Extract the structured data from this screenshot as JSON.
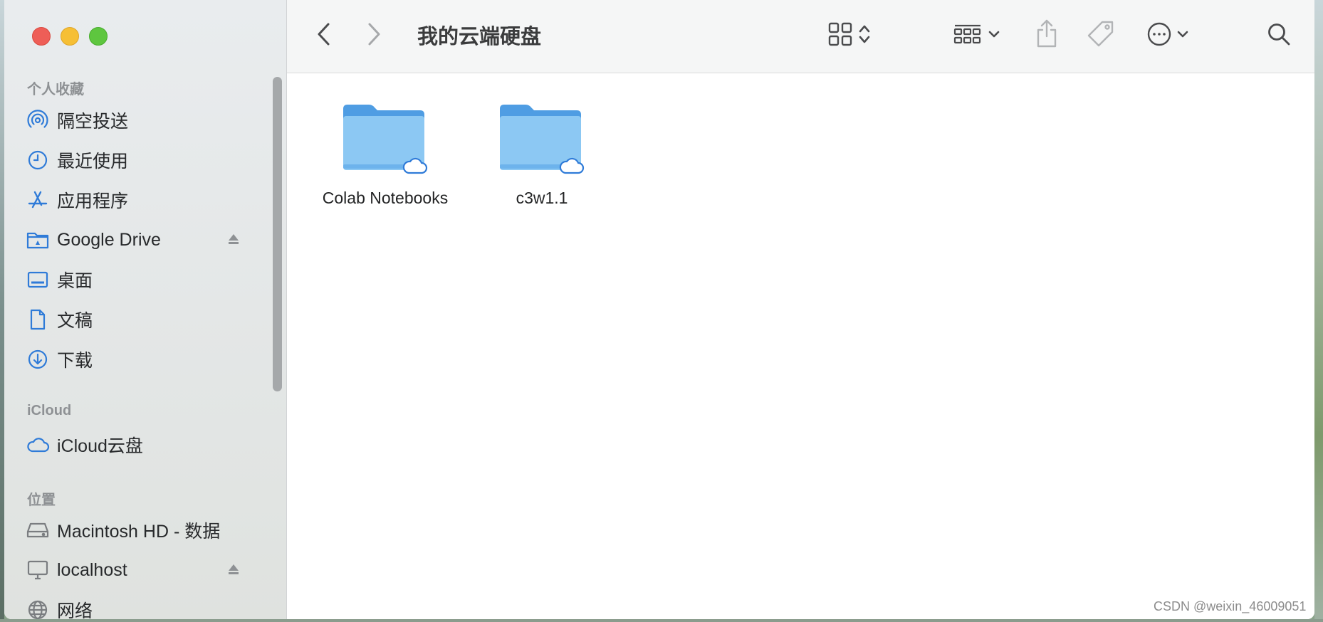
{
  "window": {
    "title": "我的云端硬盘"
  },
  "sidebar": {
    "sections": [
      {
        "label": "个人收藏"
      },
      {
        "label": "iCloud"
      },
      {
        "label": "位置"
      }
    ],
    "favorites": [
      {
        "label": "隔空投送",
        "icon": "airdrop-icon"
      },
      {
        "label": "最近使用",
        "icon": "clock-icon"
      },
      {
        "label": "应用程序",
        "icon": "applications-icon"
      },
      {
        "label": "Google Drive",
        "icon": "google-drive-folder-icon"
      },
      {
        "label": "桌面",
        "icon": "desktop-icon"
      },
      {
        "label": "文稿",
        "icon": "document-icon"
      },
      {
        "label": "下载",
        "icon": "download-icon"
      }
    ],
    "icloud": [
      {
        "label": "iCloud云盘",
        "icon": "icloud-icon"
      }
    ],
    "locations": [
      {
        "label": "Macintosh HD - 数据",
        "icon": "hard-drive-icon"
      },
      {
        "label": "localhost",
        "icon": "computer-icon"
      },
      {
        "label": "网络",
        "icon": "network-icon"
      }
    ]
  },
  "files": [
    {
      "name": "Colab Notebooks",
      "icon": "cloud-folder-icon"
    },
    {
      "name": "c3w1.1",
      "icon": "cloud-folder-icon"
    }
  ],
  "watermark": "CSDN @weixin_46009051",
  "colors": {
    "accent": "#2f7bd8",
    "folder": "#8cc8f3",
    "folder_tab": "#5aa5e6",
    "close": "#ee5e57",
    "minimize": "#f6bf35",
    "maximize": "#5ec63f"
  }
}
